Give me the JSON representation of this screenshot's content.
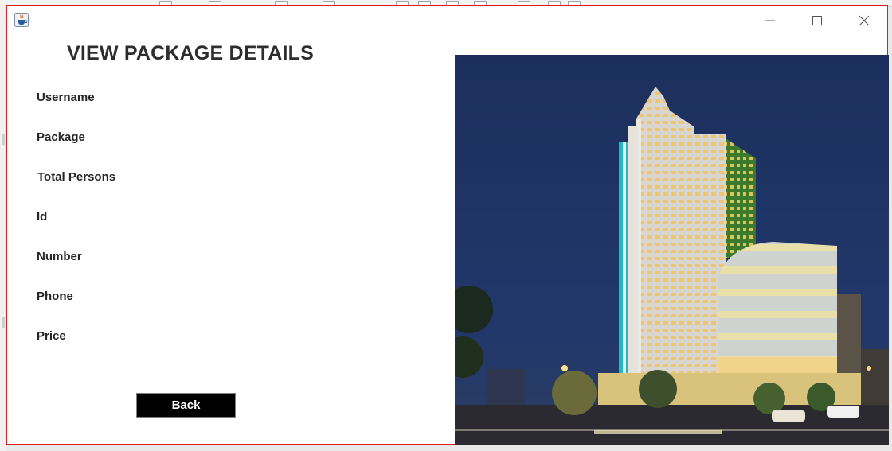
{
  "window": {
    "controls": {
      "minimize": "minimize-icon",
      "maximize": "maximize-icon",
      "close": "close-icon"
    },
    "icon": "java-coffee-icon"
  },
  "page": {
    "title": "VIEW PACKAGE DETAILS"
  },
  "fields": [
    {
      "label": "Username"
    },
    {
      "label": "Package"
    },
    {
      "label": "Total Persons"
    },
    {
      "label": "Id"
    },
    {
      "label": "Number"
    },
    {
      "label": "Phone"
    },
    {
      "label": "Price"
    }
  ],
  "buttons": {
    "back_label": "Back"
  },
  "colors": {
    "window_border": "#e01c1c",
    "button_bg": "#000000",
    "button_text": "#ffffff",
    "sky": "#1f3566"
  }
}
